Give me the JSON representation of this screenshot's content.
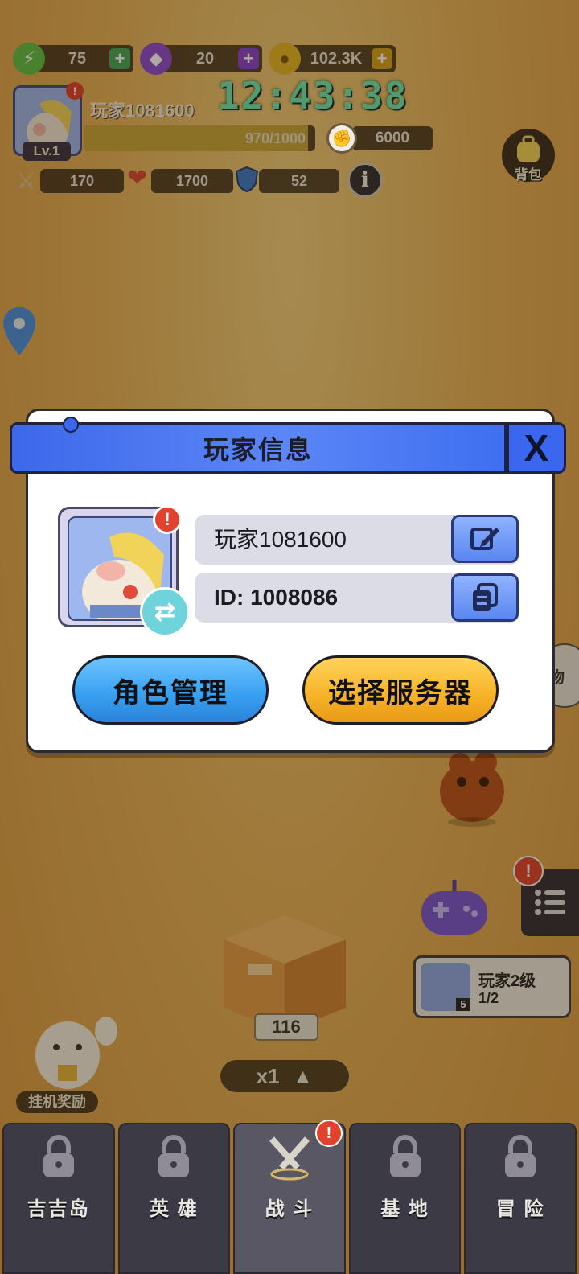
{
  "resources": {
    "energy": "75",
    "gems": "20",
    "coins": "102.3K"
  },
  "clock": "12:43:38",
  "player": {
    "name": "玩家1081600",
    "level": "Lv.1",
    "exp_text": "970/1000",
    "exp_fraction": 0.97,
    "power": "6000"
  },
  "stats": {
    "attack": "170",
    "hp": "1700",
    "defense": "52"
  },
  "backpack_label": "背包",
  "dialog": {
    "title": "玩家信息",
    "close_label": "X",
    "name_value": "玩家1081600",
    "id_value": "ID: 1008086",
    "role_button": "角色管理",
    "server_button": "选择服务器"
  },
  "side_partial_label": "物",
  "quest": {
    "title": "玩家2级",
    "progress": "1/2",
    "badge": "5"
  },
  "chest_count": "116",
  "multiplier": "x1",
  "idle_reward_label": "挂机奖励",
  "nav": [
    "吉吉岛",
    "英 雄",
    "战 斗",
    "基 地",
    "冒 险"
  ],
  "colors": {
    "dialog_header": "#4a78f2",
    "role_button": "#3aa2f2",
    "server_button": "#f7b52b",
    "clock": "#6ee8b4"
  }
}
